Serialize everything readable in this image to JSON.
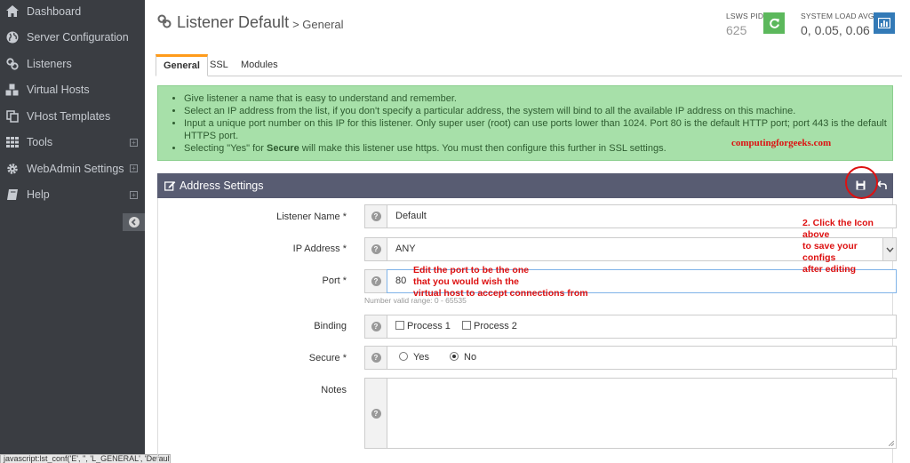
{
  "sidebar": {
    "items": [
      {
        "label": "Dashboard",
        "icon": "home-icon"
      },
      {
        "label": "Server Configuration",
        "icon": "globe-icon"
      },
      {
        "label": "Listeners",
        "icon": "link-icon"
      },
      {
        "label": "Virtual Hosts",
        "icon": "cubes-icon"
      },
      {
        "label": "VHost Templates",
        "icon": "copy-icon"
      },
      {
        "label": "Tools",
        "icon": "grid-icon",
        "expandable": true
      },
      {
        "label": "WebAdmin Settings",
        "icon": "gear-icon",
        "expandable": true
      },
      {
        "label": "Help",
        "icon": "book-icon",
        "expandable": true
      }
    ]
  },
  "status_bar": {
    "text": "javascript:lst_conf('E', '', 'L_GENERAL', 'Default')"
  },
  "header": {
    "title": "Listener Default",
    "subtitle": "> General",
    "pid_label": "LSWS PID",
    "pid_value": "625",
    "load_label": "SYSTEM LOAD AVG",
    "load_value": "0, 0.05, 0.06"
  },
  "tabs": [
    {
      "label": "General",
      "active": true
    },
    {
      "label": "SSL",
      "active": false
    },
    {
      "label": "Modules",
      "active": false
    }
  ],
  "info": {
    "bullets": [
      "Give listener a name that is easy to understand and remember.",
      "Select an IP address from the list, if you don't specify a particular address, the system will bind to all the available IP address on this machine.",
      "Input a unique port number on this IP for this listener. Only super user (root) can use ports lower than 1024. Port 80 is the default HTTP port; port 443 is the default HTTPS port."
    ],
    "secure_prefix": "Selecting \"Yes\" for ",
    "secure_bold": "Secure",
    "secure_suffix": " will make this listener use https. You must then configure this further in SSL settings.",
    "watermark": "computingforgeeks.com"
  },
  "panel": {
    "title": "Address Settings"
  },
  "form": {
    "listener_name_label": "Listener Name *",
    "listener_name_value": "Default",
    "ip_label": "IP Address *",
    "ip_value": "ANY",
    "port_label": "Port *",
    "port_value": "80",
    "port_hint": "Number valid range: 0 - 65535",
    "binding_label": "Binding",
    "binding_opt1": "Process 1",
    "binding_opt2": "Process 2",
    "secure_label": "Secure *",
    "secure_yes": "Yes",
    "secure_no": "No",
    "secure_selected": "No",
    "notes_label": "Notes"
  },
  "annotations": {
    "port_note_1": "Edit the port to be the one",
    "port_note_2": "that you would wish the",
    "port_note_3": "virtual host to accept connections from",
    "save_note_1": "2. Click the Icon above",
    "save_note_2": "to save your configs",
    "save_note_3": "after editing"
  },
  "colors": {
    "sidebar_bg": "#3a3d42",
    "panel_head": "#585c72",
    "info_bg": "#a7e0a9",
    "tab_accent": "#ff9b1a",
    "pid_button": "#5cb85c",
    "load_button": "#337ab7",
    "annotation": "#dd1111"
  }
}
